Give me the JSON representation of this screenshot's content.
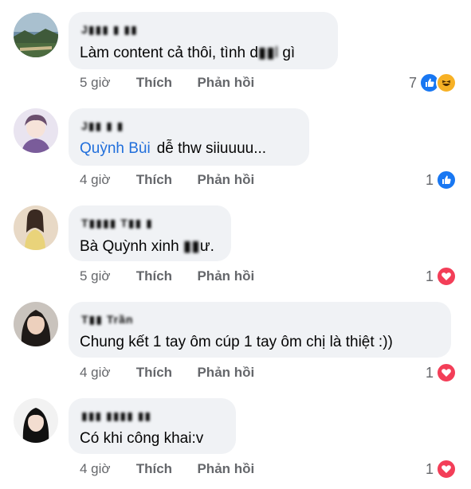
{
  "comments": [
    {
      "author": "J▮▮▮ ▮ ▮▮",
      "text": "Làm content cả thôi, tình d",
      "text_blur": "▮▮l",
      "text_after": " gì",
      "tag": "",
      "time": "5 giờ",
      "like_label": "Thích",
      "reply_label": "Phản hồi",
      "reaction_count": "7",
      "reactions": [
        "like-icon",
        "haha-icon"
      ]
    },
    {
      "author": "J▮▮ ▮ ▮",
      "text": "dễ thw siiuuuu...",
      "text_blur": "",
      "text_after": "",
      "tag": "Quỳnh Bùi",
      "time": "4 giờ",
      "like_label": "Thích",
      "reply_label": "Phản hồi",
      "reaction_count": "1",
      "reactions": [
        "like-icon"
      ]
    },
    {
      "author": "T▮▮▮▮ T▮▮ ▮",
      "text": "Bà Quỳnh xinh ",
      "text_blur": "▮▮",
      "text_after": "ư.",
      "tag": "",
      "time": "5 giờ",
      "like_label": "Thích",
      "reply_label": "Phản hồi",
      "reaction_count": "1",
      "reactions": [
        "love-icon"
      ]
    },
    {
      "author": "T▮▮ Trần",
      "text": "Chung kết 1 tay ôm cúp 1 tay ôm chị là thiệt :))",
      "text_blur": "",
      "text_after": "",
      "tag": "",
      "time": "4 giờ",
      "like_label": "Thích",
      "reply_label": "Phản hồi",
      "reaction_count": "1",
      "reactions": [
        "love-icon"
      ]
    },
    {
      "author": "▮▮▮ ▮▮▮▮ ▮▮",
      "text": "Có khi công khai:v",
      "text_blur": "",
      "text_after": "",
      "tag": "",
      "time": "4 giờ",
      "like_label": "Thích",
      "reply_label": "Phản hồi",
      "reaction_count": "1",
      "reactions": [
        "love-icon"
      ]
    }
  ],
  "colors": {
    "bubble": "#f0f2f5",
    "tag": "#216fdb",
    "like": "#1877f2",
    "love": "#f33e58",
    "haha": "#f7b125",
    "meta": "#65676b"
  }
}
